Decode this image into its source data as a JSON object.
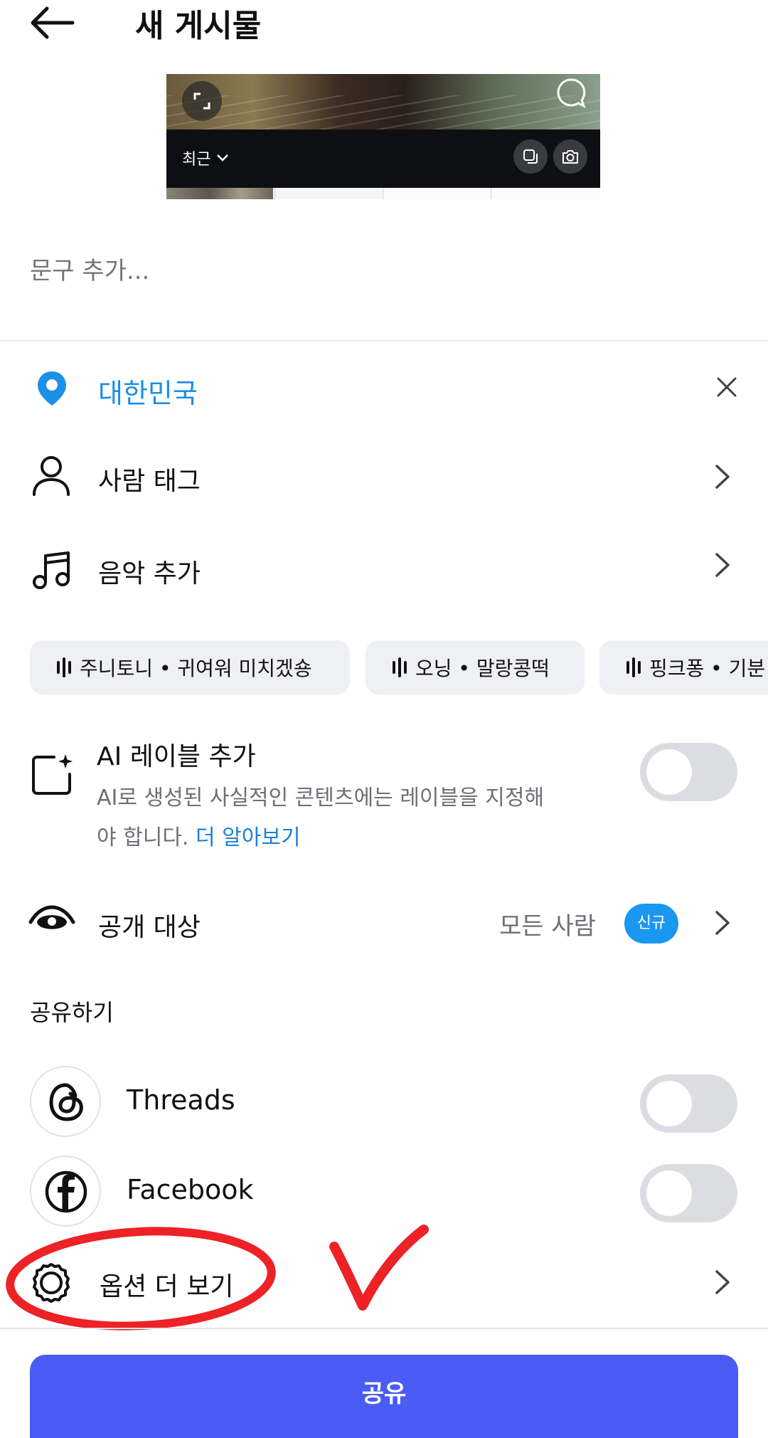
{
  "header": {
    "title": "새 게시물"
  },
  "media_picker": {
    "album_label": "최근"
  },
  "caption": {
    "placeholder": "문구 추가..."
  },
  "location": {
    "value": "대한민국"
  },
  "tag_people": {
    "label": "사람 태그"
  },
  "add_music": {
    "label": "음악 추가"
  },
  "music_chips": [
    {
      "label": "주니토니 • 귀여워 미치겠숑"
    },
    {
      "label": "오닝 • 말랑콩떡"
    },
    {
      "label": "핑크퐁 • 기분"
    }
  ],
  "ai_label": {
    "title": "AI 레이블 추가",
    "description": "AI로 생성된 사실적인 콘텐츠에는 레이블을 지정해야 합니다.",
    "learn_more": "더 알아보기",
    "enabled": false
  },
  "audience": {
    "label": "공개 대상",
    "value": "모든 사람",
    "badge": "신규"
  },
  "share_section": {
    "title": "공유하기",
    "items": [
      {
        "label": "Threads",
        "icon": "threads-icon",
        "enabled": false
      },
      {
        "label": "Facebook",
        "icon": "facebook-icon",
        "enabled": false
      }
    ]
  },
  "more_options": {
    "label": "옵션 더 보기"
  },
  "footer": {
    "share_button": "공유"
  },
  "colors": {
    "accent": "#1c8fe6",
    "primary_button": "#4a5cf5",
    "annotation": "#ec2227",
    "badge": "#1a97f0"
  }
}
